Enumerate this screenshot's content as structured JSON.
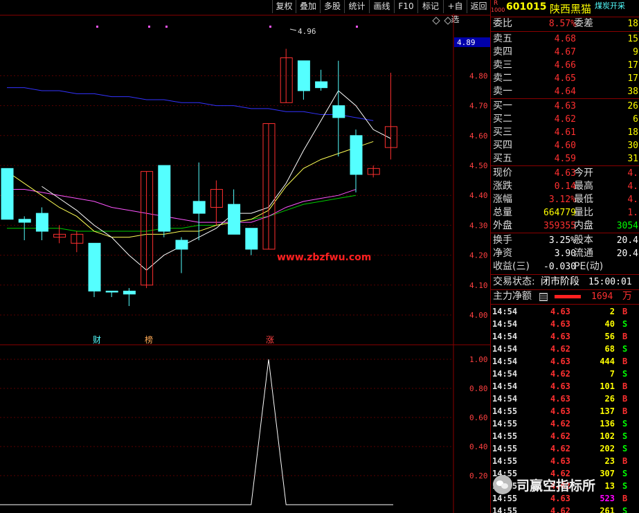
{
  "toolbar": [
    "复权",
    "叠加",
    "多股",
    "统计",
    "画线",
    "F10",
    "标记",
    "+自选",
    "返回"
  ],
  "chart": {
    "price_axis": [
      "4.80",
      "4.70",
      "4.60",
      "4.50",
      "4.40",
      "4.30",
      "4.20",
      "4.10",
      "4.00"
    ],
    "current_price_tag": "4.89",
    "high_annotation": "4.96",
    "watermark": "www.zbzfwu.com",
    "event_markers": [
      "财",
      "榜",
      "涨"
    ],
    "indicator_axis": [
      "1.00",
      "0.80",
      "0.60",
      "0.40",
      "0.20"
    ],
    "colors": {
      "up": "#ff3030",
      "down": "#54ffff",
      "ma5": "#ffffff",
      "ma10": "#ffff55",
      "ma20": "#ff55ff",
      "ma30": "#00cc00",
      "ma60": "#3333ff"
    }
  },
  "chart_data": {
    "type": "candlestick",
    "candles": [
      {
        "o": 4.49,
        "h": 4.49,
        "l": 4.32,
        "c": 4.32,
        "dir": "down"
      },
      {
        "o": 4.32,
        "h": 4.33,
        "l": 4.25,
        "c": 4.31,
        "dir": "down"
      },
      {
        "o": 4.34,
        "h": 4.36,
        "l": 4.25,
        "c": 4.28,
        "dir": "down"
      },
      {
        "o": 4.26,
        "h": 4.3,
        "l": 4.24,
        "c": 4.27,
        "dir": "up"
      },
      {
        "o": 4.24,
        "h": 4.28,
        "l": 4.21,
        "c": 4.27,
        "dir": "up"
      },
      {
        "o": 4.24,
        "h": 4.24,
        "l": 4.06,
        "c": 4.08,
        "dir": "down"
      },
      {
        "o": 4.08,
        "h": 4.08,
        "l": 4.06,
        "c": 4.08,
        "dir": "down"
      },
      {
        "o": 4.08,
        "h": 4.09,
        "l": 4.03,
        "c": 4.07,
        "dir": "down"
      },
      {
        "o": 4.1,
        "h": 4.48,
        "l": 4.09,
        "c": 4.48,
        "dir": "up"
      },
      {
        "o": 4.5,
        "h": 4.5,
        "l": 4.26,
        "c": 4.28,
        "dir": "down"
      },
      {
        "o": 4.25,
        "h": 4.26,
        "l": 4.14,
        "c": 4.22,
        "dir": "down"
      },
      {
        "o": 4.38,
        "h": 4.51,
        "l": 4.25,
        "c": 4.34,
        "dir": "down"
      },
      {
        "o": 4.36,
        "h": 4.45,
        "l": 4.3,
        "c": 4.42,
        "dir": "up"
      },
      {
        "o": 4.37,
        "h": 4.42,
        "l": 4.27,
        "c": 4.27,
        "dir": "down"
      },
      {
        "o": 4.29,
        "h": 4.29,
        "l": 4.2,
        "c": 4.22,
        "dir": "down"
      },
      {
        "o": 4.22,
        "h": 4.64,
        "l": 4.22,
        "c": 4.64,
        "dir": "up"
      },
      {
        "o": 4.71,
        "h": 4.89,
        "l": 4.71,
        "c": 4.86,
        "dir": "up"
      },
      {
        "o": 4.85,
        "h": 4.85,
        "l": 4.72,
        "c": 4.75,
        "dir": "down"
      },
      {
        "o": 4.78,
        "h": 4.82,
        "l": 4.75,
        "c": 4.76,
        "dir": "down"
      },
      {
        "o": 4.7,
        "h": 4.85,
        "l": 4.53,
        "c": 4.66,
        "dir": "down"
      },
      {
        "o": 4.6,
        "h": 4.62,
        "l": 4.41,
        "c": 4.47,
        "dir": "down"
      },
      {
        "o": 4.47,
        "h": 4.5,
        "l": 4.46,
        "c": 4.49,
        "dir": "up"
      },
      {
        "o": 4.56,
        "h": 4.81,
        "l": 4.52,
        "c": 4.63,
        "dir": "up"
      }
    ],
    "ma5": [
      4.43,
      4.39,
      4.35,
      4.3,
      4.26,
      4.2,
      4.15,
      4.2,
      4.23,
      4.26,
      4.29,
      4.34,
      4.34,
      4.36,
      4.44,
      4.55,
      4.65,
      4.75,
      4.7,
      4.62,
      4.59
    ],
    "ma10": [
      4.48,
      4.44,
      4.4,
      4.36,
      4.33,
      4.28,
      4.26,
      4.26,
      4.27,
      4.27,
      4.28,
      4.28,
      4.3,
      4.31,
      4.32,
      4.35,
      4.43,
      4.49,
      4.52,
      4.54,
      4.56,
      4.58
    ],
    "ma20": [
      4.42,
      4.42,
      4.41,
      4.4,
      4.39,
      4.38,
      4.36,
      4.35,
      4.34,
      4.33,
      4.32,
      4.31,
      4.31,
      4.31,
      4.31,
      4.33,
      4.36,
      4.38,
      4.39,
      4.4,
      4.42
    ],
    "ma30": [
      4.29,
      4.29,
      4.29,
      4.29,
      4.28,
      4.28,
      4.28,
      4.28,
      4.28,
      4.29,
      4.29,
      4.3,
      4.3,
      4.31,
      4.32,
      4.33,
      4.35,
      4.37,
      4.38,
      4.39,
      4.4
    ],
    "ma60": [
      4.76,
      4.76,
      4.75,
      4.75,
      4.74,
      4.74,
      4.73,
      4.73,
      4.72,
      4.72,
      4.71,
      4.71,
      4.7,
      4.7,
      4.69,
      4.69,
      4.68,
      4.68,
      4.67,
      4.67,
      4.66,
      4.65
    ],
    "indicator": {
      "peak_at_candle": 15,
      "peak_value": 1.0,
      "baseline": 0.0
    }
  },
  "quote": {
    "code": "601015",
    "name": "陕西黑猫",
    "tag": "煤炭开采",
    "badge_r": "R",
    "badge_num": "1000",
    "weibi_label": "委比",
    "weibi": "8.57%",
    "weicha_label": "委差",
    "weicha": "18",
    "sells": [
      {
        "label": "卖五",
        "price": "4.68",
        "vol": "15"
      },
      {
        "label": "卖四",
        "price": "4.67",
        "vol": "9"
      },
      {
        "label": "卖三",
        "price": "4.66",
        "vol": "17"
      },
      {
        "label": "卖二",
        "price": "4.65",
        "vol": "17"
      },
      {
        "label": "卖一",
        "price": "4.64",
        "vol": "38"
      }
    ],
    "buys": [
      {
        "label": "买一",
        "price": "4.63",
        "vol": "26"
      },
      {
        "label": "买二",
        "price": "4.62",
        "vol": "6"
      },
      {
        "label": "买三",
        "price": "4.61",
        "vol": "18"
      },
      {
        "label": "买四",
        "price": "4.60",
        "vol": "30"
      },
      {
        "label": "买五",
        "price": "4.59",
        "vol": "31"
      }
    ],
    "stats": [
      {
        "l1": "现价",
        "v1": "4.63",
        "c1": "red",
        "l2": "今开",
        "v2": "4.",
        "c2": "red"
      },
      {
        "l1": "涨跌",
        "v1": "0.14",
        "c1": "red",
        "l2": "最高",
        "v2": "4.",
        "c2": "red"
      },
      {
        "l1": "涨幅",
        "v1": "3.12%",
        "c1": "red",
        "l2": "最低",
        "v2": "4.",
        "c2": "red"
      },
      {
        "l1": "总量",
        "v1": "664779",
        "c1": "yellow",
        "l2": "量比",
        "v2": "1.",
        "c2": "red"
      },
      {
        "l1": "外盘",
        "v1": "359355",
        "c1": "red",
        "l2": "内盘",
        "v2": "3054",
        "c2": "green"
      }
    ],
    "stats2": [
      {
        "l1": "换手",
        "v1": "3.25%",
        "c1": "white",
        "l2": "股本",
        "v2": "20.4"
      },
      {
        "l1": "净资",
        "v1": "3.90",
        "c1": "white",
        "l2": "流通",
        "v2": "20.4"
      },
      {
        "l1": "收益(三)",
        "v1": "-0.030",
        "c1": "white",
        "l2": "PE(动)",
        "v2": ""
      }
    ],
    "status_label": "交易状态:",
    "status_value": "闭市阶段",
    "status_time": "15:00:01",
    "main_net_label": "主力净额",
    "main_net_value": "1694",
    "main_net_unit": "万",
    "ticks": [
      {
        "t": "14:54",
        "p": "4.63",
        "pc": "red",
        "v": "2",
        "vc": "yellow",
        "d": "B"
      },
      {
        "t": "14:54",
        "p": "4.63",
        "pc": "red",
        "v": "40",
        "vc": "yellow",
        "d": "S"
      },
      {
        "t": "14:54",
        "p": "4.63",
        "pc": "red",
        "v": "56",
        "vc": "yellow",
        "d": "B"
      },
      {
        "t": "14:54",
        "p": "4.62",
        "pc": "red",
        "v": "68",
        "vc": "yellow",
        "d": "S"
      },
      {
        "t": "14:54",
        "p": "4.63",
        "pc": "red",
        "v": "444",
        "vc": "yellow",
        "d": "B"
      },
      {
        "t": "14:54",
        "p": "4.62",
        "pc": "red",
        "v": "7",
        "vc": "yellow",
        "d": "S"
      },
      {
        "t": "14:54",
        "p": "4.63",
        "pc": "red",
        "v": "101",
        "vc": "yellow",
        "d": "B"
      },
      {
        "t": "14:54",
        "p": "4.63",
        "pc": "red",
        "v": "26",
        "vc": "yellow",
        "d": "B"
      },
      {
        "t": "14:55",
        "p": "4.63",
        "pc": "red",
        "v": "137",
        "vc": "yellow",
        "d": "B"
      },
      {
        "t": "14:55",
        "p": "4.62",
        "pc": "red",
        "v": "136",
        "vc": "yellow",
        "d": "S"
      },
      {
        "t": "14:55",
        "p": "4.62",
        "pc": "red",
        "v": "102",
        "vc": "yellow",
        "d": "S"
      },
      {
        "t": "14:55",
        "p": "4.62",
        "pc": "red",
        "v": "202",
        "vc": "yellow",
        "d": "S"
      },
      {
        "t": "14:55",
        "p": "4.63",
        "pc": "red",
        "v": "23",
        "vc": "yellow",
        "d": "B"
      },
      {
        "t": "14:55",
        "p": "4.62",
        "pc": "red",
        "v": "307",
        "vc": "yellow",
        "d": "S"
      },
      {
        "t": "14:55",
        "p": "4.62",
        "pc": "red",
        "v": "13",
        "vc": "yellow",
        "d": "S"
      },
      {
        "t": "14:55",
        "p": "4.63",
        "pc": "red",
        "v": "523",
        "vc": "magenta",
        "d": "B"
      },
      {
        "t": "14:55",
        "p": "4.62",
        "pc": "red",
        "v": "261",
        "vc": "yellow",
        "d": "S"
      }
    ]
  },
  "overlay_brand": "司赢空指标所"
}
